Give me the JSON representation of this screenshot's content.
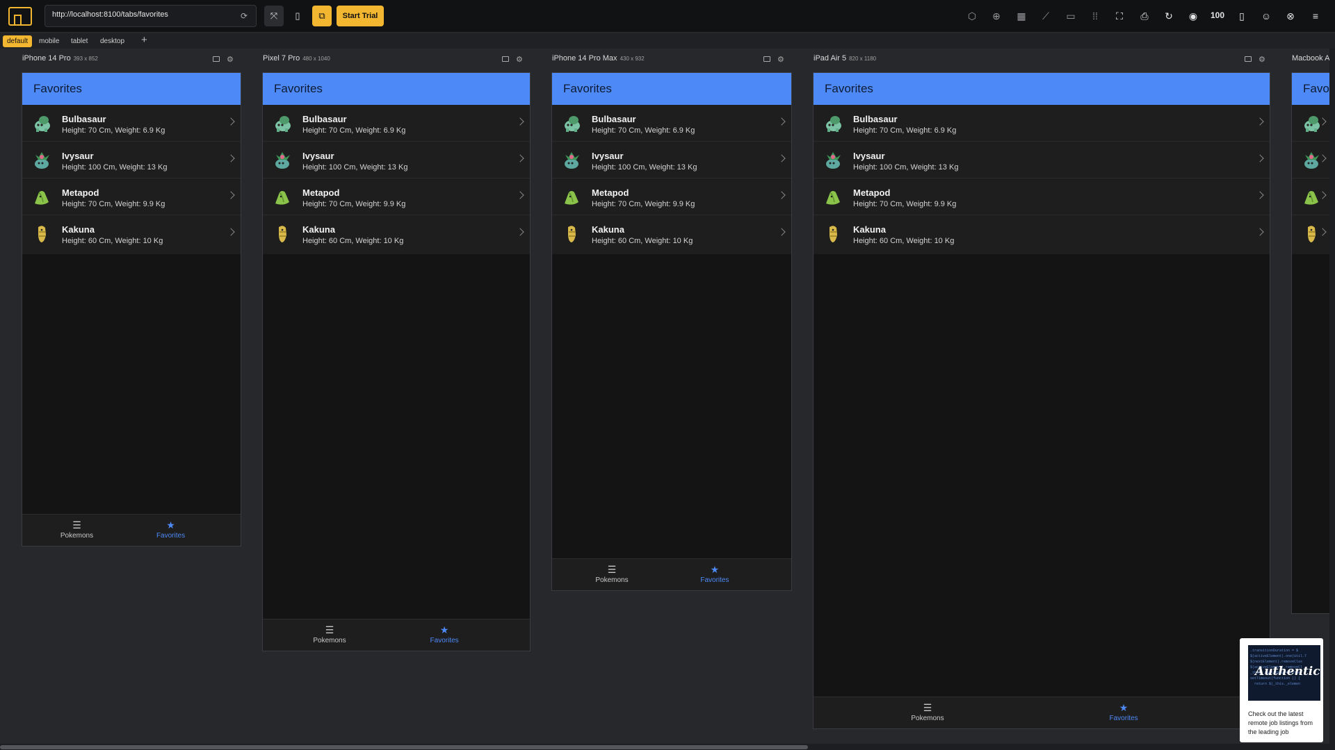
{
  "toolbar": {
    "url": "http://localhost:8100/tabs/favorites",
    "start_trial": "Start Trial",
    "zoom": "100",
    "icons": [
      "cube-icon",
      "layers-icon",
      "grid-icon",
      "ruler-icon",
      "slider-icon",
      "dots-grid-icon",
      "screenshot-frame-icon",
      "print-icon",
      "rotate-icon",
      "camera-icon",
      "zoom-label",
      "device-icon",
      "discord-icon",
      "close-circle-icon",
      "menu-icon"
    ]
  },
  "presets": [
    "default",
    "mobile",
    "tablet",
    "desktop"
  ],
  "app": {
    "title": "Favorites",
    "items": [
      {
        "name": "Bulbasaur",
        "meta": "Height: 70 Cm, Weight: 6.9 Kg"
      },
      {
        "name": "Ivysaur",
        "meta": "Height: 100 Cm, Weight: 13 Kg"
      },
      {
        "name": "Metapod",
        "meta": "Height: 70 Cm, Weight: 9.9 Kg"
      },
      {
        "name": "Kakuna",
        "meta": "Height: 60 Cm, Weight: 10 Kg"
      }
    ],
    "tabs": {
      "pokemons": "Pokemons",
      "favorites": "Favorites"
    },
    "accent": "#4e8af7"
  },
  "devices": [
    {
      "name": "iPhone 14 Pro",
      "size": "393 x 852"
    },
    {
      "name": "Pixel 7 Pro",
      "size": "480 x 1040"
    },
    {
      "name": "iPhone 14 Pro Max",
      "size": "430 x 932"
    },
    {
      "name": "iPad Air 5",
      "size": "820 x 1180"
    },
    {
      "name": "Macbook A",
      "size": ""
    }
  ],
  "ad": {
    "brand": "Authentic",
    "text": "Check out the latest remote job listings from the leading job"
  }
}
